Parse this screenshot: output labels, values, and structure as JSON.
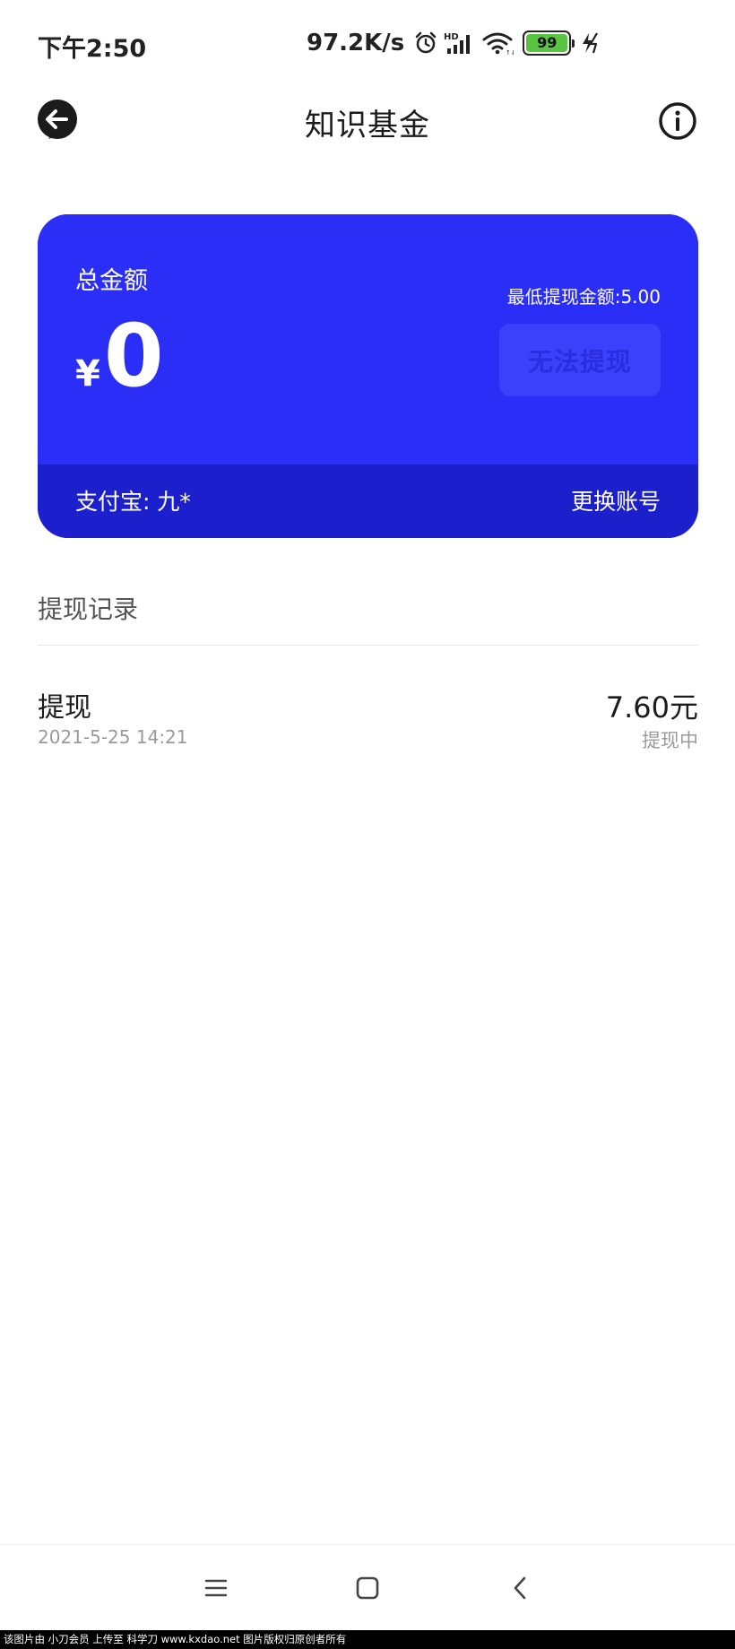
{
  "status_bar": {
    "time": "下午2:50",
    "net_speed": "97.2K/s",
    "battery_level": "99",
    "icons": [
      "alarm-icon",
      "hd-signal-icon",
      "wifi-icon",
      "battery-icon",
      "charging-icon"
    ]
  },
  "header": {
    "title": "知识基金",
    "back_icon": "back-arrow-icon",
    "info_icon": "info-icon"
  },
  "card": {
    "label": "总金额",
    "currency_symbol": "¥",
    "amount": "0",
    "min_withdraw": "最低提现金额:5.00",
    "withdraw_button": "无法提现",
    "account": "支付宝: 九*",
    "change_account": "更换账号",
    "colors": {
      "card_bg": "#2a2ef7",
      "card_footer_bg": "#1c1fcc",
      "button_bg": "#3b41fb"
    }
  },
  "records": {
    "title": "提现记录",
    "items": [
      {
        "type": "提现",
        "time": "2021-5-25 14:21",
        "amount": "7.60元",
        "status": "提现中"
      }
    ]
  },
  "nav_bar": {
    "icons": [
      "menu-icon",
      "home-icon",
      "back-icon"
    ]
  },
  "watermark": {
    "text": "该图片由 小刀会员 上传至 科学刀 www.kxdao.net 图片版权归原创者所有"
  }
}
